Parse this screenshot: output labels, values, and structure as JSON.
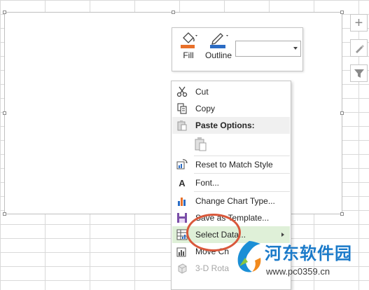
{
  "mini_toolbar": {
    "fill_label": "Fill",
    "outline_label": "Outline",
    "dropdown_value": ""
  },
  "context_menu": {
    "items": [
      {
        "label": "Cut",
        "icon": "scissors-icon"
      },
      {
        "label": "Copy",
        "icon": "copy-icon"
      },
      {
        "label": "Paste Options:",
        "icon": "paste-icon"
      },
      {
        "label": "",
        "icon": "paste-option-icon"
      },
      {
        "label": "Reset to Match Style",
        "icon": "reset-style-icon"
      },
      {
        "label": "Font...",
        "icon": "font-icon"
      },
      {
        "label": "Change Chart Type...",
        "icon": "chart-type-icon"
      },
      {
        "label": "Save as Template...",
        "icon": "save-template-icon"
      },
      {
        "label": "Select Data...",
        "icon": "select-data-icon"
      },
      {
        "label": "Move Ch",
        "icon": "move-chart-icon"
      },
      {
        "label": "3-D Rota",
        "icon": "rotation-icon"
      }
    ]
  },
  "watermark": {
    "text": "河东软件园",
    "url": "www.pc0359.cn"
  },
  "colors": {
    "accent_orange": "#e8702a",
    "accent_blue": "#2b6cc4",
    "highlight_green": "#dff0d8",
    "circle_red": "#d9583b"
  }
}
